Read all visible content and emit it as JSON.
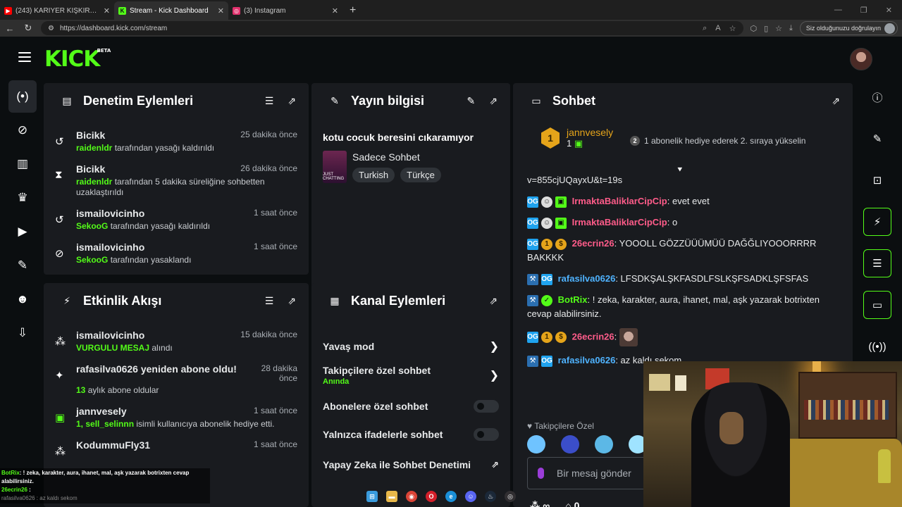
{
  "browser": {
    "tabs": [
      {
        "title": "(243) KARİYER KIŞKIRTMASI !! - O",
        "favicon": "youtube-icon",
        "color": "#ff0000",
        "active": false
      },
      {
        "title": "Stream - Kick Dashboard",
        "favicon": "kick-icon",
        "color": "#53fc18",
        "active": true
      },
      {
        "title": "(3) Instagram",
        "favicon": "instagram-icon",
        "color": "#e1306c",
        "active": false
      }
    ],
    "url": "https://dashboard.kick.com/stream",
    "verify_label": "Siz olduğunuzu doğrulayın"
  },
  "app": {
    "logo": "KICK",
    "logo_badge": "BETA"
  },
  "moderation": {
    "title": "Denetim Eylemleri",
    "items": [
      {
        "icon": "undo-icon",
        "user": "Bicikk",
        "time": "25 dakika önce",
        "actor": "raidenldr",
        "text": " tarafından yasağı kaldırıldı"
      },
      {
        "icon": "hourglass-icon",
        "user": "Bicikk",
        "time": "26 dakika önce",
        "actor": "raidenldr",
        "text": " tarafından 5 dakika süreliğine sohbetten uzaklaştırıldı"
      },
      {
        "icon": "undo-icon",
        "user": "ismailovicinho",
        "time": "1 saat önce",
        "actor": "SekooG",
        "text": " tarafından yasağı kaldırıldı"
      },
      {
        "icon": "ban-icon",
        "user": "ismailovicinho",
        "time": "1 saat önce",
        "actor": "SekooG",
        "text": " tarafından yasaklandı"
      }
    ]
  },
  "stream_info": {
    "title": "Yayın bilgisi",
    "stream_title": "kotu cocuk beresini cıkaramıyor",
    "category": "Sadece Sohbet",
    "thumb_text": "JUST CHATTING",
    "tags": [
      "Turkish",
      "Türkçe"
    ]
  },
  "chat": {
    "title": "Sohbet",
    "pinned": {
      "medal": "1",
      "user": "jannvesely",
      "count": "1",
      "n": "2",
      "message": "1 abonelik hediye ederek 2. sıraya yükselin"
    },
    "messages": [
      {
        "badges": [],
        "user": "",
        "color": "#53fc18",
        "text": "v=855cjUQayxU&t=19s"
      },
      {
        "badges": [
          "og",
          "mon",
          "sub"
        ],
        "user": "IrmaktaBaliklarCipCip",
        "color": "#ff5c8a",
        "text": ": evet evet"
      },
      {
        "badges": [
          "og",
          "mon",
          "sub"
        ],
        "user": "IrmaktaBaliklarCipCip",
        "color": "#ff5c8a",
        "text": ": o"
      },
      {
        "badges": [
          "og",
          "1",
          "gift"
        ],
        "user": "26ecrin26",
        "color": "#ff5c8a",
        "text": ": YOOOLL GÖZZÜÜÜMÜÜ DAĞĞLIYOOORRRR BAKKKK"
      },
      {
        "badges": [
          "wr",
          "og"
        ],
        "user": "rafasilva0626",
        "color": "#4fb3ff",
        "text": ": LFSDKŞALŞKFASDLFSLKŞFSADKLŞFSFAS"
      },
      {
        "badges": [
          "wr",
          "ver"
        ],
        "user": "BotRix",
        "color": "#53fc18",
        "text": ": ! zeka, karakter, aura, ihanet, mal, aşk yazarak botrixten cevap alabilirsiniz."
      },
      {
        "badges": [
          "og",
          "1",
          "gift"
        ],
        "user": "26ecrin26",
        "color": "#ff5c8a",
        "text": ":",
        "emote": true
      },
      {
        "badges": [
          "wr",
          "og"
        ],
        "user": "rafasilva0626",
        "color": "#4fb3ff",
        "text": ": az kaldı sekom"
      }
    ],
    "followers_only": "Takipçilere Özel",
    "input_placeholder": "Bir mesaj gönder",
    "viewers": "∞",
    "gifts": "0"
  },
  "activity": {
    "title": "Etkinlik Akışı",
    "items": [
      {
        "icon": "users-icon",
        "user": "ismailovicinho",
        "time": "15 dakika önce",
        "highlight": "VURGULU MESAJ",
        "text": " alındı"
      },
      {
        "icon": "sparkle-icon",
        "user": "rafasilva0626 yeniden abone oldu!",
        "time": "28 dakika önce",
        "highlight": "13",
        "text": " aylık abone oldular"
      },
      {
        "icon": "gift-icon",
        "user": "jannvesely",
        "time": "1 saat önce",
        "highlight": "1, sell_selinnn",
        "text": " isimli kullanıcıya abonelik hediye etti."
      },
      {
        "icon": "users-icon",
        "user": "KodummuFly31",
        "time": "1 saat önce",
        "highlight": "",
        "text": ""
      }
    ]
  },
  "channel_actions": {
    "title": "Kanal Eylemleri",
    "rows": [
      {
        "label": "Yavaş mod",
        "sub": "",
        "control": "chevron"
      },
      {
        "label": "Takipçilere özel sohbet",
        "sub": "Anında",
        "control": "chevron"
      },
      {
        "label": "Abonelere özel sohbet",
        "sub": "",
        "control": "toggle"
      },
      {
        "label": "Yalnızca ifadelerle sohbet",
        "sub": "",
        "control": "toggle"
      },
      {
        "label": "Yapay Zeka ile Sohbet Denetimi",
        "sub": "",
        "control": "external"
      }
    ]
  },
  "overlay_chat": {
    "line1_user": "BotRix",
    "line1_text": ": ! zeka, karakter, aura, ihanet, mal, aşk yazarak botrixten cevap alabilirsiniz.",
    "line2_user": "26ecrin26",
    "line2_text": " :",
    "line3": "rafasilva0626 : az kaldı sekom"
  }
}
